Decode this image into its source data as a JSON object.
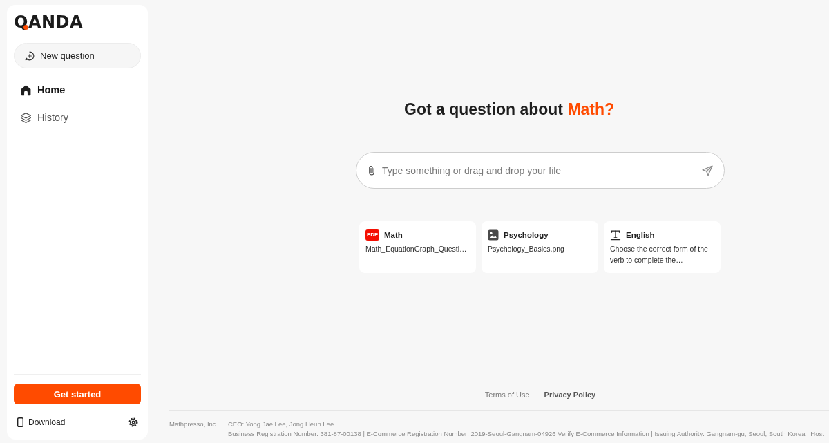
{
  "sidebar": {
    "logo": "QANDA",
    "new_question": "New question",
    "nav": [
      {
        "kind": "home",
        "label": "Home",
        "selected": true
      },
      {
        "kind": "history",
        "label": "History",
        "selected": false
      }
    ],
    "get_started": "Get started",
    "download": "Download"
  },
  "main": {
    "headline": {
      "text": "Got a question about ",
      "highlight": "Math?"
    },
    "search": {
      "placeholder": "Type something or drag and drop your file"
    },
    "examples": [
      {
        "kind": "pdf",
        "badge": "PDF",
        "title": "Math",
        "text": "Math_EquationGraph_Questi…"
      },
      {
        "kind": "image",
        "title": "Psychology",
        "text": "Psychology_Basics.png"
      },
      {
        "kind": "text",
        "title": "English",
        "text": "Choose the correct form of the verb to complete the…"
      }
    ]
  },
  "footer": {
    "links": [
      {
        "label": "Terms of Use",
        "emphasized": false
      },
      {
        "label": "Privacy Policy",
        "emphasized": true
      }
    ],
    "company": "Mathpresso, Inc.",
    "details": [
      "CEO: Yong Jae Lee, Jong Heun Lee",
      "Business Registration Number: 381-87-00138 | E-Commerce Registration Number: 2019-Seoul-Gangnam-04926 Verify E-Commerce Information | Issuing Authority: Gangnam-gu, Seoul, South Korea | Host"
    ]
  }
}
